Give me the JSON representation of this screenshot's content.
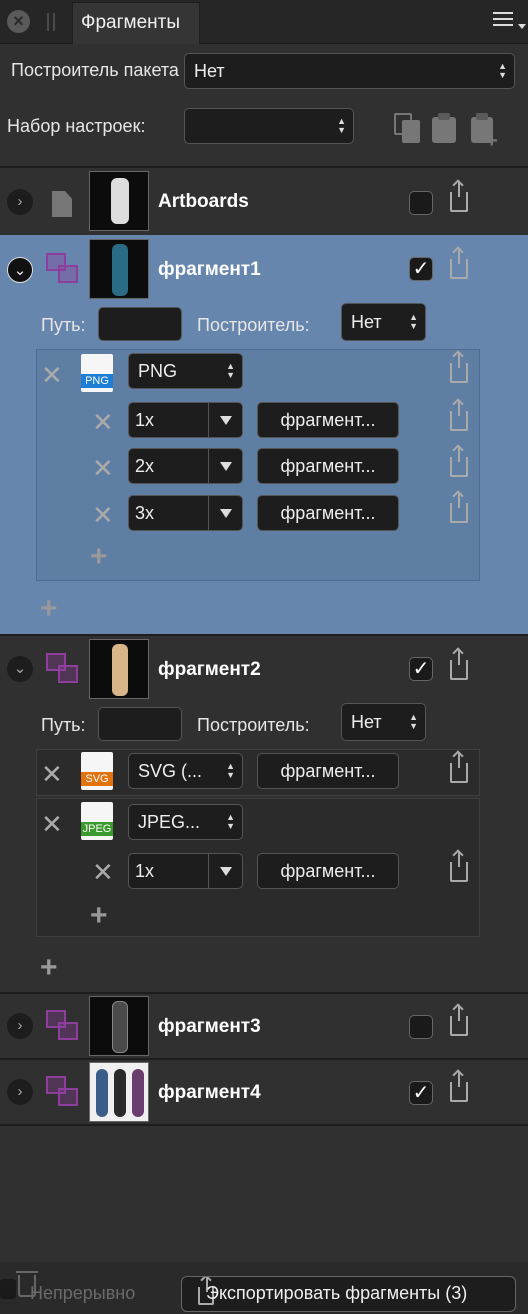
{
  "panel": {
    "tab_label": "Фрагменты"
  },
  "settings": {
    "builder_label": "Построитель пакета",
    "builder_value": "Нет",
    "preset_label": "Набор настроек:",
    "preset_value": ""
  },
  "rows": {
    "artboards": {
      "name": "Artboards",
      "checked": false
    },
    "fragment1": {
      "name": "фрагмент1",
      "checked": true,
      "path_label": "Путь:",
      "path_value": "",
      "builder_label": "Построитель:",
      "builder_value": "Нет",
      "format": {
        "type_label": "PNG",
        "format_value": "PNG"
      },
      "scales": [
        {
          "scale": "1x",
          "name": "фрагмент..."
        },
        {
          "scale": "2x",
          "name": "фрагмент..."
        },
        {
          "scale": "3x",
          "name": "фрагмент..."
        }
      ]
    },
    "fragment2": {
      "name": "фрагмент2",
      "checked": true,
      "path_label": "Путь:",
      "path_value": "",
      "builder_label": "Построитель:",
      "builder_value": "Нет",
      "svg": {
        "type_label": "SVG",
        "format_value": "SVG (...",
        "name": "фрагмент..."
      },
      "jpeg": {
        "type_label": "JPEG",
        "format_value": "JPEG...",
        "scale": "1x",
        "name": "фрагмент..."
      }
    },
    "fragment3": {
      "name": "фрагмент3",
      "checked": false
    },
    "fragment4": {
      "name": "фрагмент4",
      "checked": true
    }
  },
  "footer": {
    "continuous_label": "Непрерывно",
    "export_button": "Экспортировать фрагменты (3)"
  },
  "colors": {
    "selected_row": "#6686ad",
    "slice_icon": "#8e3f9e",
    "png_tag": "#1f7fd6",
    "svg_tag": "#e2730f",
    "jpeg_tag": "#3b9a2d"
  }
}
